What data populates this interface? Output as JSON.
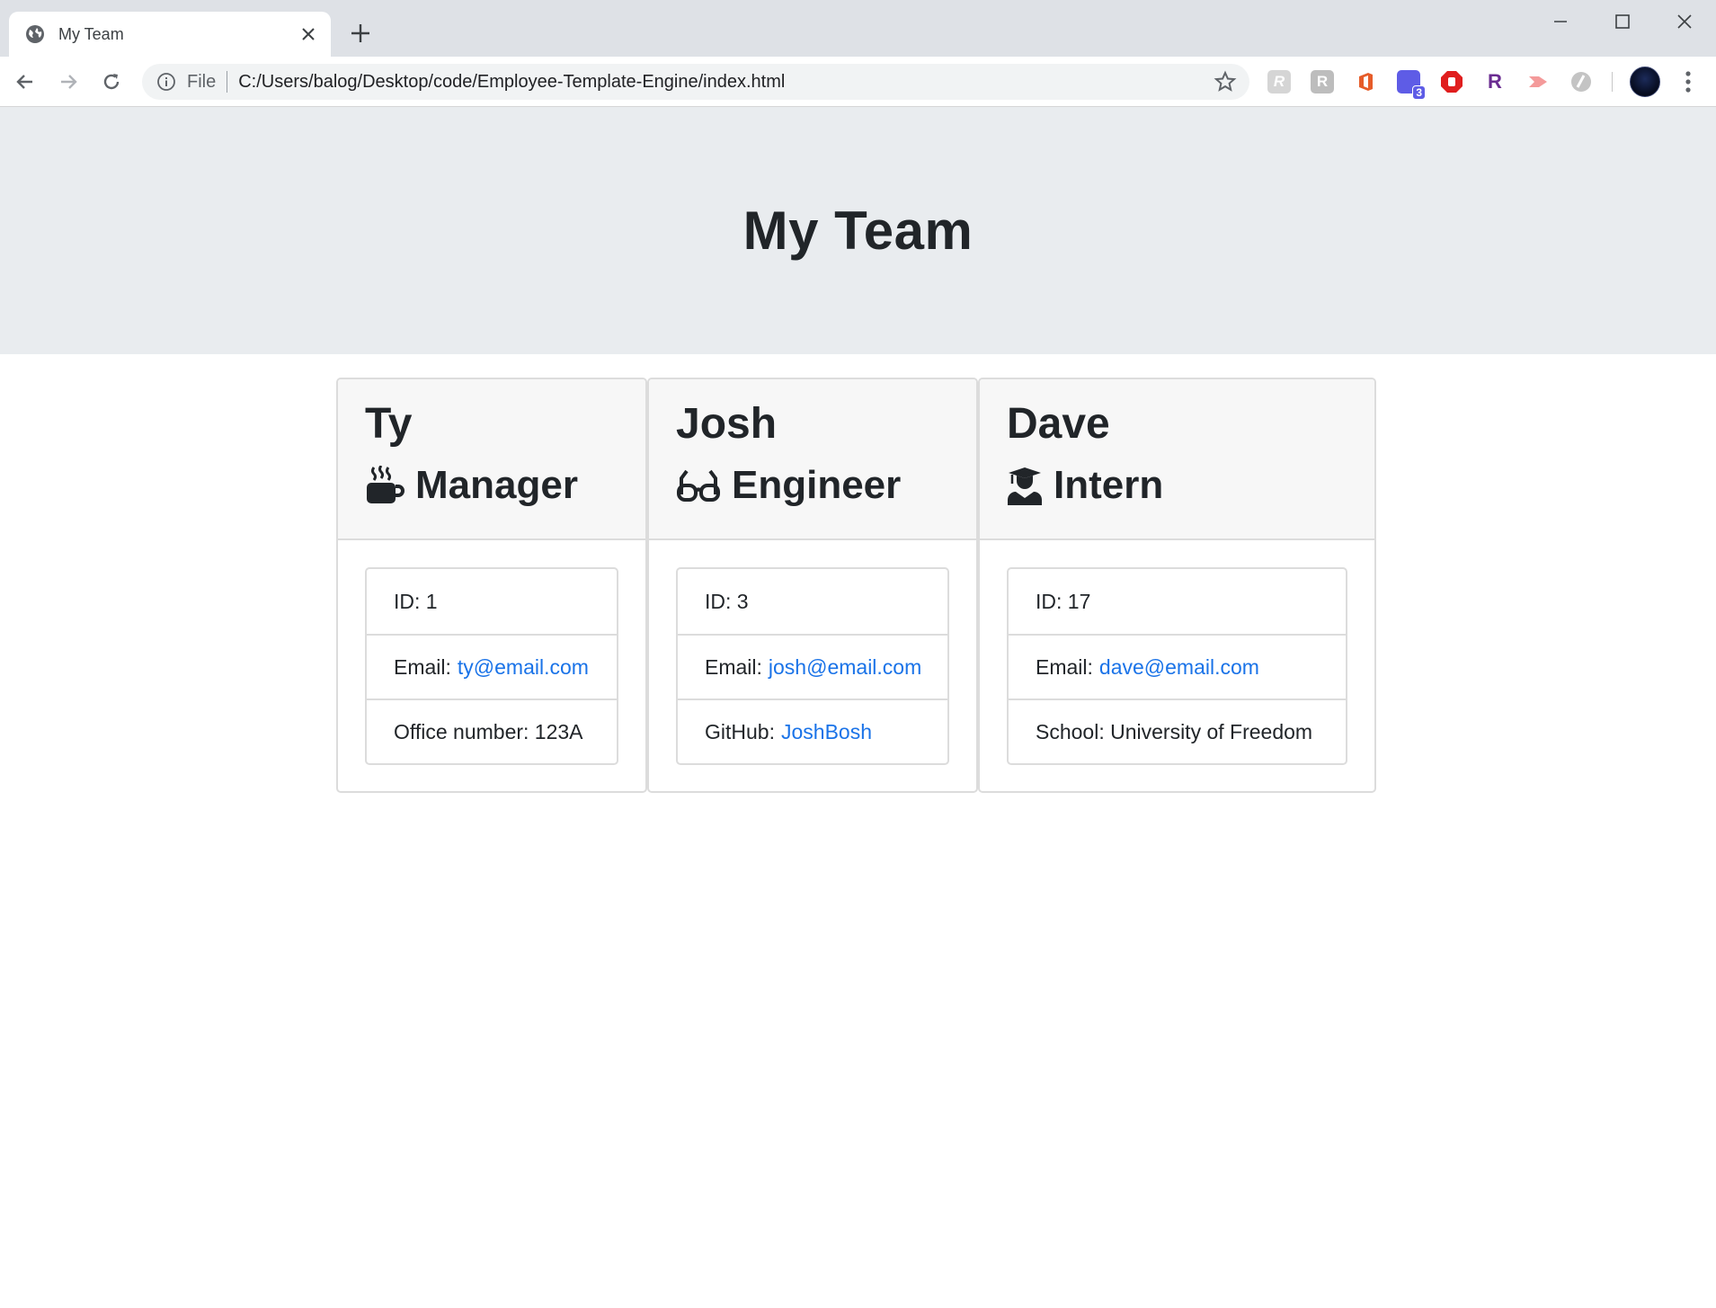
{
  "browser": {
    "tab_title": "My Team",
    "url_scheme": "File",
    "url": "C:/Users/balog/Desktop/code/Employee-Template-Engine/index.html",
    "extensions": [
      {
        "name": "extension-r-script-icon",
        "glyph": "R",
        "color": "#bdbdbd"
      },
      {
        "name": "extension-r-box-icon",
        "glyph": "R",
        "color": "#bdbdbd"
      },
      {
        "name": "office-icon",
        "glyph": "",
        "color": "#e65c29"
      },
      {
        "name": "extension-badge-icon",
        "glyph": "3",
        "color": "#5e5ce6"
      },
      {
        "name": "adblock-icon",
        "glyph": "",
        "color": "#e01e1e"
      },
      {
        "name": "extension-r-purple-icon",
        "glyph": "R",
        "color": "#6a2c91"
      },
      {
        "name": "extension-arrow-icon",
        "glyph": "",
        "color": "#f08080"
      },
      {
        "name": "extension-grey-icon",
        "glyph": "",
        "color": "#bdbdbd"
      }
    ]
  },
  "page": {
    "title": "My Team"
  },
  "team": [
    {
      "name": "Ty",
      "role": "Manager",
      "role_icon": "mug-icon",
      "id_label": "ID: 1",
      "email_label": "Email:",
      "email": "ty@email.com",
      "extra_label": "Office number: 123A",
      "extra_link": ""
    },
    {
      "name": "Josh",
      "role": "Engineer",
      "role_icon": "glasses-icon",
      "id_label": "ID: 3",
      "email_label": "Email:",
      "email": "josh@email.com",
      "extra_label": "GitHub:",
      "extra_link": "JoshBosh"
    },
    {
      "name": "Dave",
      "role": "Intern",
      "role_icon": "graduate-icon",
      "id_label": "ID: 17",
      "email_label": "Email:",
      "email": "dave@email.com",
      "extra_label": "School: University of Freedom",
      "extra_link": ""
    }
  ],
  "colors": {
    "link": "#1a73e8",
    "jumbotron_bg": "#e9ecef",
    "card_header_bg": "#f7f7f7"
  }
}
